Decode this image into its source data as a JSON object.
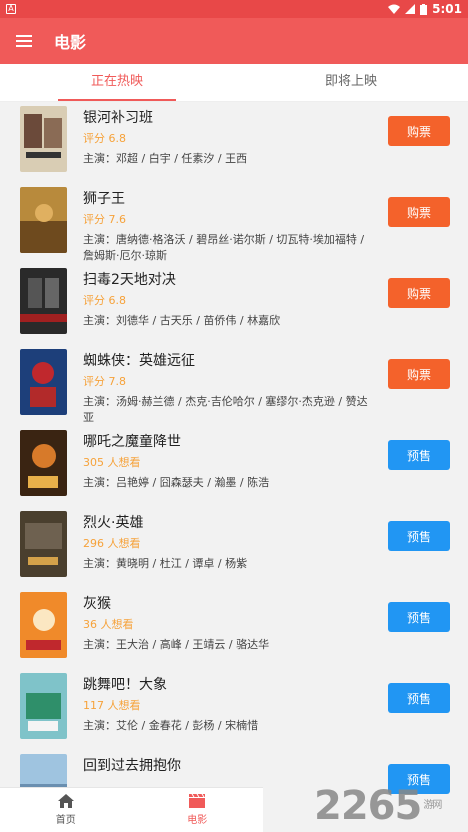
{
  "status": {
    "time": "5:01"
  },
  "app_bar": {
    "title": "电影"
  },
  "tabs": [
    {
      "label": "正在热映"
    },
    {
      "label": "即将上映"
    }
  ],
  "movies": [
    {
      "title": "银河补习班",
      "meta": "评分 6.8",
      "cast": "主演：邓超 / 白宇 / 任素汐 / 王西",
      "button": "购票"
    },
    {
      "title": "狮子王",
      "meta": "评分 7.6",
      "cast": "主演：唐纳德·格洛沃 / 碧昂丝·诺尔斯 / 切瓦特·埃加福特 / 詹姆斯·厄尔·琼斯",
      "button": "购票"
    },
    {
      "title": "扫毒2天地对决",
      "meta": "评分 6.8",
      "cast": "主演：刘德华 / 古天乐 / 苗侨伟 / 林嘉欣",
      "button": "购票"
    },
    {
      "title": "蜘蛛侠：英雄远征",
      "meta": "评分 7.8",
      "cast": "主演：汤姆·赫兰德 / 杰克·吉伦哈尔 / 塞缪尔·杰克逊 / 赞达亚",
      "button": "购票"
    },
    {
      "title": "哪吒之魔童降世",
      "meta": "305 人想看",
      "cast": "主演：吕艳婷 / 囧森瑟夫 / 瀚墨 / 陈浩",
      "button": "预售"
    },
    {
      "title": "烈火·英雄",
      "meta": "296 人想看",
      "cast": "主演：黄晓明 / 杜江 / 谭卓 / 杨紫",
      "button": "预售"
    },
    {
      "title": "灰猴",
      "meta": "36 人想看",
      "cast": "主演：王大治 / 高峰 / 王靖云 / 骆达华",
      "button": "预售"
    },
    {
      "title": "跳舞吧！大象",
      "meta": "117 人想看",
      "cast": "主演：艾伦 / 金春花 / 彭杨 / 宋楠惜",
      "button": "预售"
    },
    {
      "title": "回到过去拥抱你",
      "meta": "",
      "cast": "",
      "button": "预售"
    }
  ],
  "bottom_nav": [
    {
      "label": "首页"
    },
    {
      "label": "电影"
    }
  ],
  "watermark": {
    "text": "2265",
    "side": "游网"
  }
}
